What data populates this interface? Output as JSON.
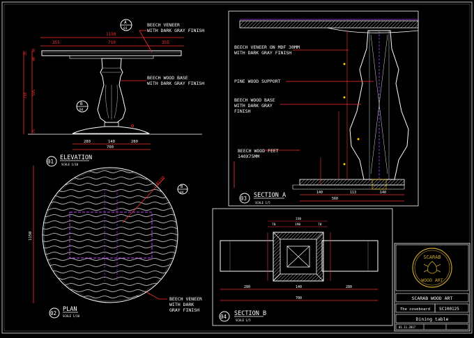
{
  "elevation": {
    "title": "ELEVATION",
    "number": "01",
    "scale": "SCALE 1/10",
    "dims_top": {
      "overall": "1150",
      "left": "355",
      "center": "710",
      "right": "355"
    },
    "dims_side": {
      "a": "35",
      "b": "40",
      "c": "30",
      "total": "710",
      "mid": "595",
      "base": "75"
    },
    "dims_bottom": {
      "left": "280",
      "center": "140",
      "right": "280",
      "overall": "700"
    },
    "marker_top": {
      "id": "A",
      "sheet": "03"
    },
    "marker_mid": {
      "id": "B",
      "sheet": "04"
    },
    "notes": {
      "top_line1": "BEECH VENEER",
      "top_line2": "WITH DARK GRAY FINISH",
      "base_line1": "BEECH WOOD BASE",
      "base_line2": "WITH DARK GRAY FINISH"
    }
  },
  "plan": {
    "title": "PLAN",
    "number": "02",
    "scale": "SCALE 1/10",
    "dim_vertical": "1150",
    "dim_diameter": "Ø1150",
    "marker": {
      "id": "B",
      "sheet": "04"
    },
    "note_line1": "BEECH VENEER",
    "note_line2": "WITH DARK",
    "note_line3": "GRAY FINISH"
  },
  "section_a": {
    "title": "SECTION A",
    "number": "03",
    "scale": "SCALE 1/5",
    "notes": {
      "n1_line1": "BEECH VENEER ON MDF 30MM",
      "n1_line2": "WITH DARK GRAY FINISH",
      "n2": "PINE WOOD SUPPORT",
      "n3_line1": "BEECH WOOD BASE",
      "n3_line2": "WITH DARK GRAY",
      "n3_line3": "FINISH",
      "n4_line1": "BEECH WOOD FEET",
      "n4_line2": "140X75MM"
    },
    "dims_bottom": {
      "left": "140",
      "center": "113",
      "right": "140",
      "overall": "560"
    }
  },
  "section_b": {
    "title": "SECTION B",
    "number": "04",
    "scale": "SCALE 1/5",
    "dims_top": {
      "overall": "330",
      "inner": "190",
      "a": "70",
      "b": "70"
    },
    "dims_bottom": {
      "left": "280",
      "center": "140",
      "right": "280",
      "overall": "700"
    }
  },
  "title_block": {
    "logo_line1": "SCARAB",
    "logo_line2": "WOOD ART",
    "company": "SCARAB WOOD ART",
    "client": "The coveboard",
    "sheet_code": "SC100125",
    "drawing_title": "Dining table",
    "date": "01.11.2017"
  }
}
